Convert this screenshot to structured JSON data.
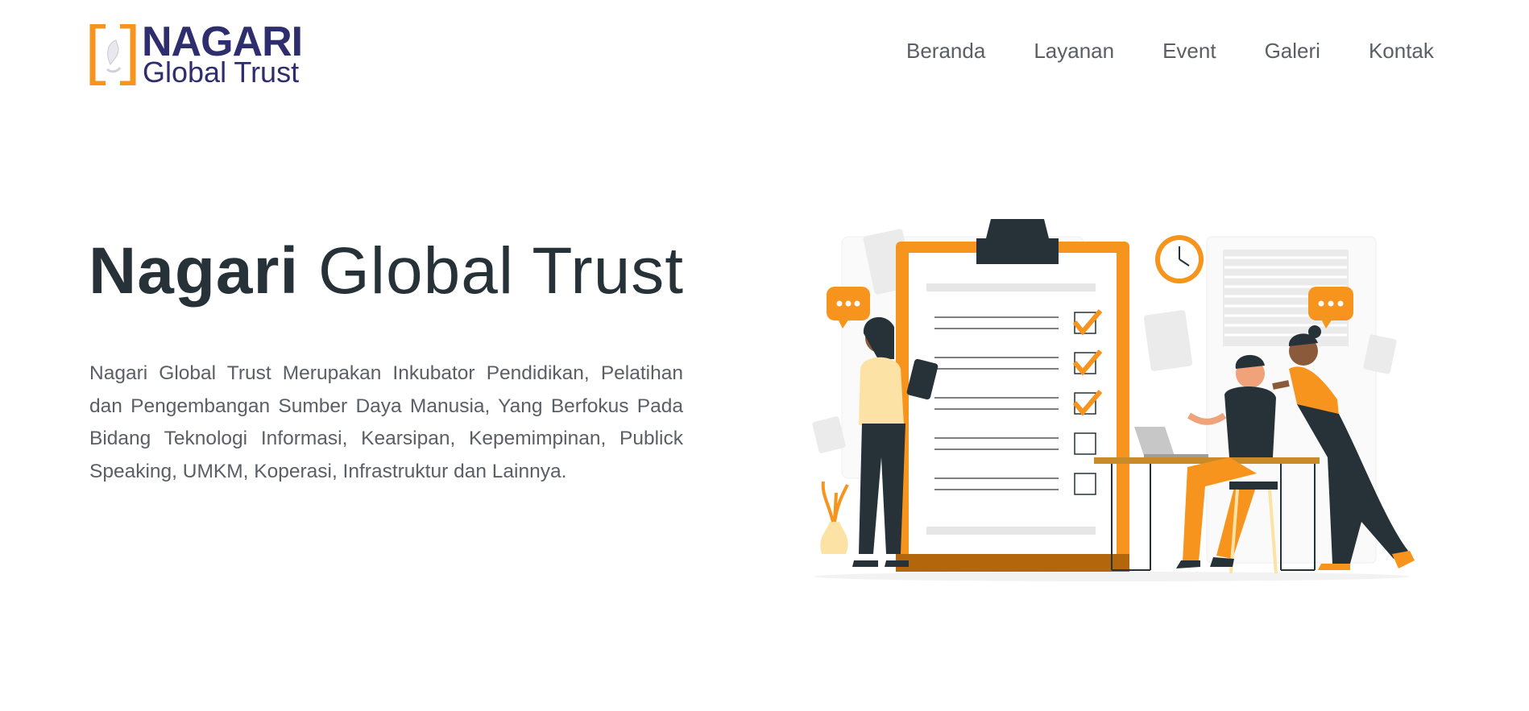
{
  "brand": {
    "name_line1": "NAGARI",
    "name_line2": "Global Trust",
    "primary_color": "#2e2d6e",
    "accent_color": "#f7941d"
  },
  "nav": {
    "items": [
      "Beranda",
      "Layanan",
      "Event",
      "Galeri",
      "Kontak"
    ]
  },
  "hero": {
    "title_bold": "Nagari",
    "title_rest": "Global Trust",
    "description": "Nagari Global Trust Merupakan Inkubator Pendidikan, Pelatihan dan Pengembangan Sumber Daya Manusia, Yang Berfokus Pada Bidang Teknologi Informasi, Kearsipan, Kepemimpinan, Publick Speaking, UMKM, Koperasi, Infrastruktur dan Lainnya.",
    "illustration_icon": "checklist-team-illustration",
    "checklist_checked": [
      true,
      true,
      true,
      false,
      false
    ]
  }
}
